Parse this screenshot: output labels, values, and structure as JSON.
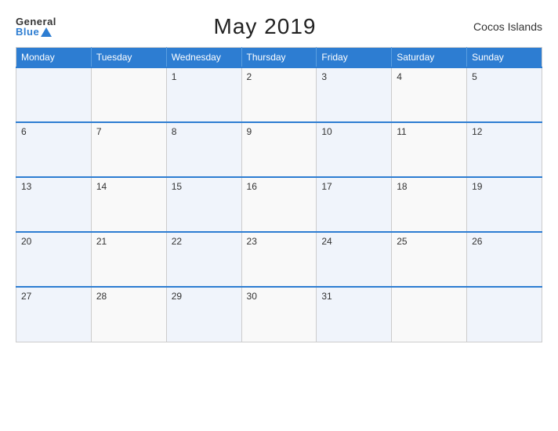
{
  "header": {
    "logo_general": "General",
    "logo_blue": "Blue",
    "title": "May 2019",
    "region": "Cocos Islands"
  },
  "weekdays": [
    "Monday",
    "Tuesday",
    "Wednesday",
    "Thursday",
    "Friday",
    "Saturday",
    "Sunday"
  ],
  "weeks": [
    [
      "",
      "",
      "1",
      "2",
      "3",
      "4",
      "5"
    ],
    [
      "6",
      "7",
      "8",
      "9",
      "10",
      "11",
      "12"
    ],
    [
      "13",
      "14",
      "15",
      "16",
      "17",
      "18",
      "19"
    ],
    [
      "20",
      "21",
      "22",
      "23",
      "24",
      "25",
      "26"
    ],
    [
      "27",
      "28",
      "29",
      "30",
      "31",
      "",
      ""
    ]
  ]
}
